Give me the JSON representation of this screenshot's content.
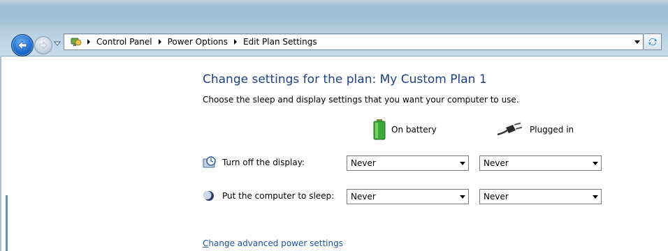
{
  "address_bar": {
    "crumbs": [
      "Control Panel",
      "Power Options",
      "Edit Plan Settings"
    ]
  },
  "main": {
    "title": "Change settings for the plan: My Custom Plan 1",
    "subtitle": "Choose the sleep and display settings that you want your computer to use.",
    "columns": {
      "battery": "On battery",
      "plugged": "Plugged in"
    },
    "rows": [
      {
        "label": "Turn off the display:",
        "battery_value": "Never",
        "plugged_value": "Never",
        "icon": "display-timer-icon"
      },
      {
        "label": "Put the computer to sleep:",
        "battery_value": "Never",
        "plugged_value": "Never",
        "icon": "sleep-moon-icon"
      }
    ],
    "advanced_link_first": "C",
    "advanced_link_rest": "hange advanced power settings"
  },
  "colors": {
    "heading": "#1e3f8a",
    "link": "#1e50a0",
    "back_button": "#1f6fd1"
  }
}
